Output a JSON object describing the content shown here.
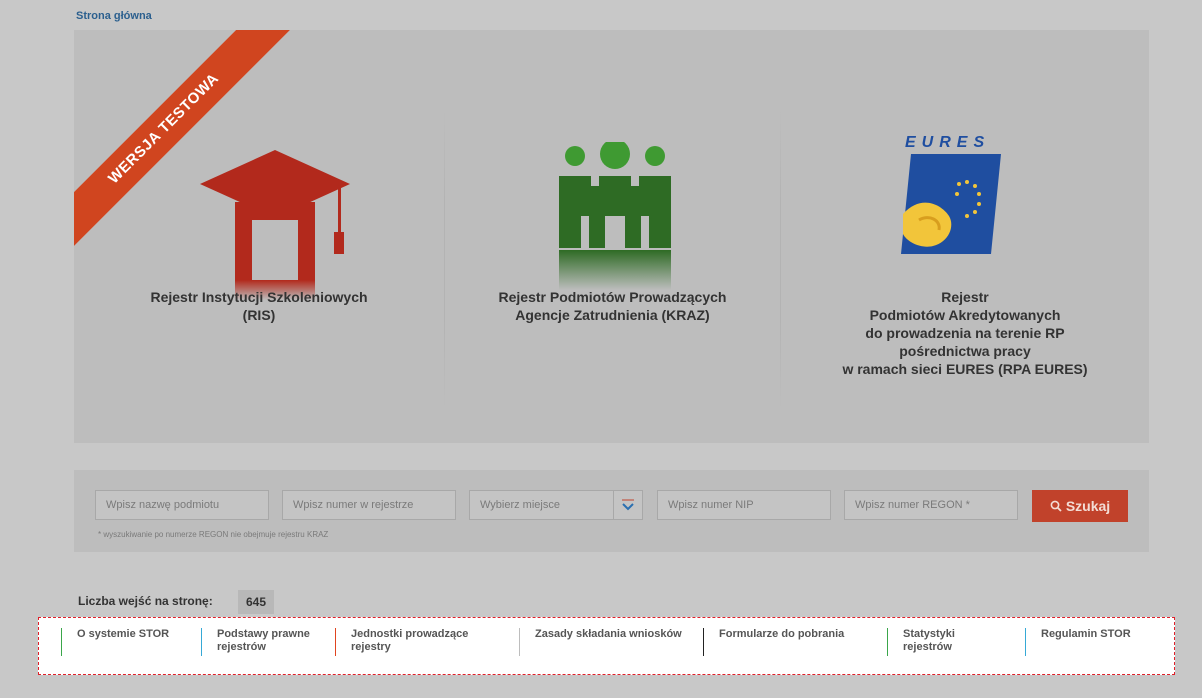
{
  "breadcrumb": "Strona główna",
  "ribbon": "WERSJA TESTOWA",
  "registers": [
    {
      "title_lines": [
        "Rejestr Instytucji Szkoleniowych",
        "(RIS)"
      ]
    },
    {
      "title_lines": [
        "Rejestr Podmiotów Prowadzących",
        "Agencje Zatrudnienia (KRAZ)"
      ]
    },
    {
      "title_lines": [
        "Rejestr",
        "Podmiotów Akredytowanych",
        "do prowadzenia na terenie RP",
        "pośrednictwa pracy",
        "w ramach sieci EURES (RPA EURES)"
      ],
      "logo_text": "EURES"
    }
  ],
  "search": {
    "name_placeholder": "Wpisz nazwę podmiotu",
    "register_number_placeholder": "Wpisz numer w rejestrze",
    "place_select": "Wybierz miejsce",
    "nip_placeholder": "Wpisz numer NIP",
    "regon_placeholder": "Wpisz numer REGON *",
    "button_label": "Szukaj",
    "note": "* wyszukiwanie po numerze REGON nie obejmuje rejestru KRAZ"
  },
  "visits": {
    "label": "Liczba wejść na stronę:",
    "count": "645"
  },
  "footer": [
    {
      "label_lines": [
        "O systemie STOR"
      ],
      "color": "#3aa64a"
    },
    {
      "label_lines": [
        "Podstawy prawne",
        "rejestrów"
      ],
      "color": "#36a9d6"
    },
    {
      "label_lines": [
        "Jednostki prowadzące",
        "rejestry"
      ],
      "color": "#e0441f"
    },
    {
      "label_lines": [
        "Zasady składania wniosków"
      ],
      "color": "#bdbdbd"
    },
    {
      "label_lines": [
        "Formularze do pobrania"
      ],
      "color": "#222222"
    },
    {
      "label_lines": [
        "Statystyki",
        "rejestrów"
      ],
      "color": "#3aa64a"
    },
    {
      "label_lines": [
        "Regulamin STOR"
      ],
      "color": "#36a9d6"
    }
  ],
  "colors": {
    "ris_icon": "#b2291c",
    "kraz_icon": "#2e6b24",
    "eures_blue": "#1f4ea0",
    "eures_yellow": "#f2c53a",
    "ribbon": "#d0451f",
    "search_button": "#c1422b"
  }
}
